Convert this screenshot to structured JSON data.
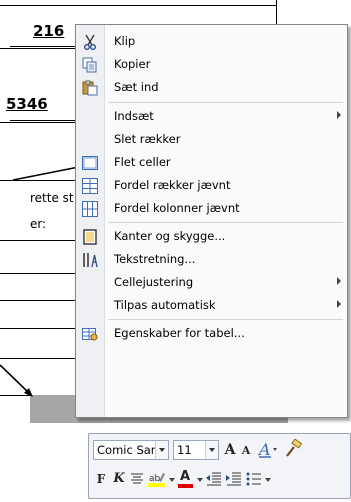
{
  "document": {
    "number_1": "216",
    "number_2": "5346",
    "text_1": "rette st",
    "text_2": "er:"
  },
  "context_menu": {
    "items": [
      {
        "label": "Klip",
        "icon": "scissors-icon"
      },
      {
        "label": "Kopier",
        "icon": "copy-icon"
      },
      {
        "label": "Sæt ind",
        "icon": "paste-icon"
      },
      {
        "label": "Indsæt",
        "submenu": true
      },
      {
        "label": "Slet rækker"
      },
      {
        "label": "Flet celler",
        "icon": "merge-cells-icon"
      },
      {
        "label": "Fordel rækker jævnt",
        "icon": "distribute-rows-icon"
      },
      {
        "label": "Fordel kolonner jævnt",
        "icon": "distribute-columns-icon"
      },
      {
        "label": "Kanter og skygge...",
        "icon": "borders-icon"
      },
      {
        "label": "Tekstretning...",
        "icon": "text-direction-icon"
      },
      {
        "label": "Cellejustering",
        "submenu": true
      },
      {
        "label": "Tilpas automatisk",
        "submenu": true
      },
      {
        "label": "Egenskaber for tabel...",
        "icon": "table-properties-icon"
      }
    ]
  },
  "mini_toolbar": {
    "font_name": "Comic Sans",
    "font_size": "11",
    "bold": "F",
    "italic": "K",
    "grow_font": "A",
    "shrink_font": "A",
    "font_color": "A"
  },
  "colors": {
    "menu_background": "#fafafa",
    "gutter": "#eef0f4",
    "highlight_color": "#ffff00",
    "font_color_bar": "#e00000",
    "table_gray": "#a6a6a6"
  }
}
